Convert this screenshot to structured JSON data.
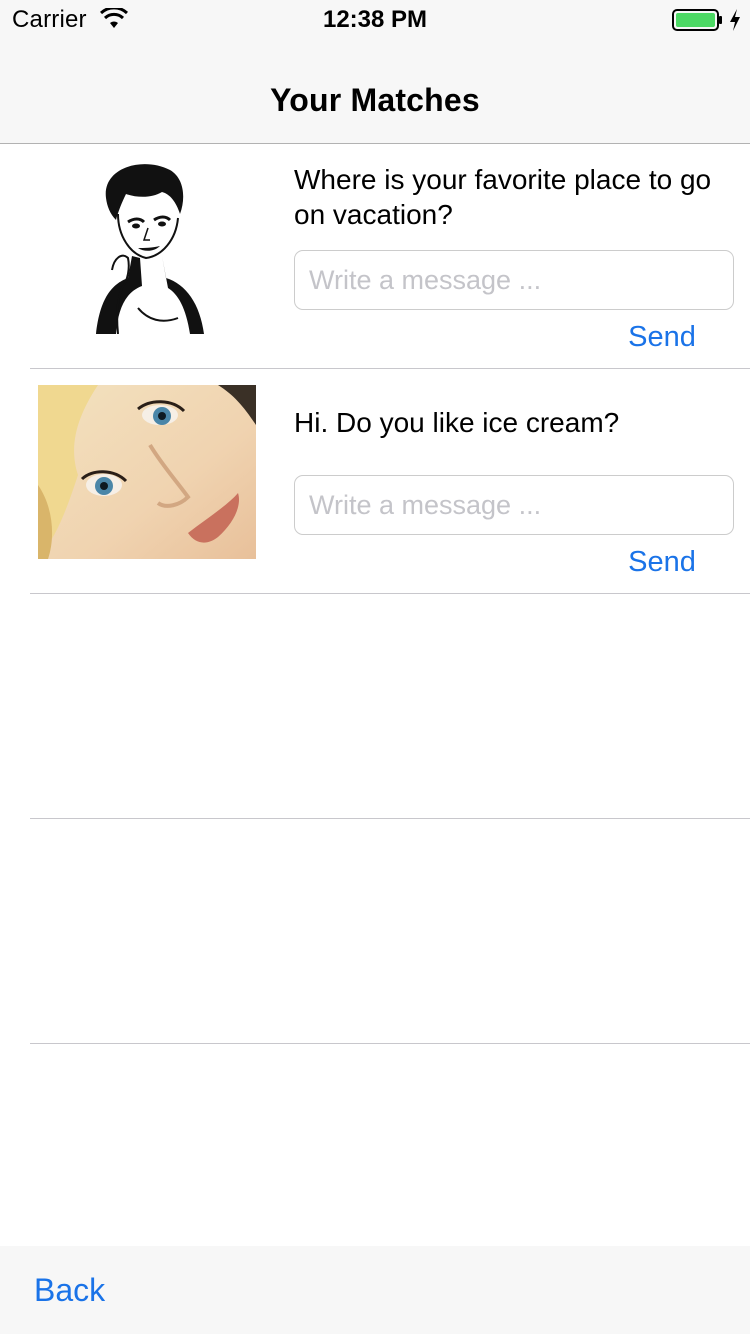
{
  "status_bar": {
    "carrier": "Carrier",
    "time": "12:38 PM",
    "wifi_icon": "wifi-icon",
    "battery_icon": "battery-full-icon",
    "battery_color": "#4cd964"
  },
  "nav": {
    "title": "Your Matches"
  },
  "matches": [
    {
      "avatar": "illustrated-woman-portrait",
      "question": "Where is your favorite place to go on vacation?",
      "input_value": "",
      "input_placeholder": "Write a message ...",
      "send_label": "Send"
    },
    {
      "avatar": "woman-face-photo",
      "question": "Hi.  Do you like ice cream?",
      "input_value": "",
      "input_placeholder": "Write a message ...",
      "send_label": "Send"
    }
  ],
  "toolbar": {
    "back_label": "Back"
  },
  "colors": {
    "accent": "#1a73e8",
    "separator": "#c8c7cc",
    "bar_background": "#f7f7f7"
  }
}
